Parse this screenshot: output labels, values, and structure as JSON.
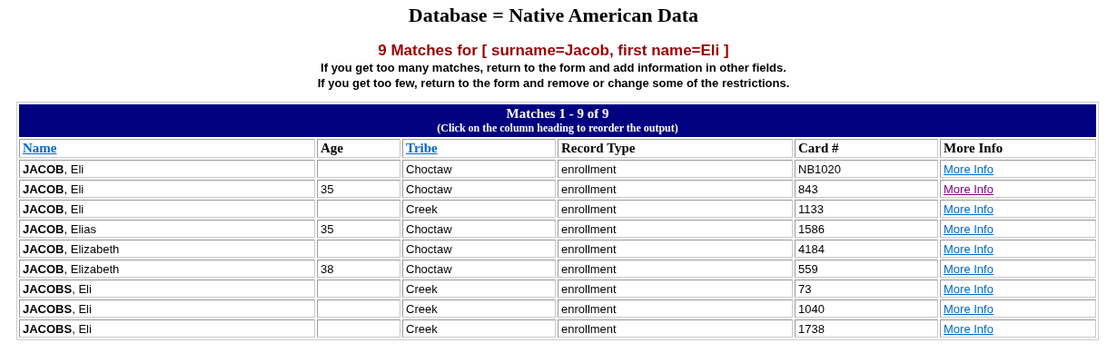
{
  "title": "Database = Native American Data",
  "matches_heading": "9 Matches for [ surname=Jacob, first name=Eli ]",
  "hints": [
    "If you get too many matches, return to the form and add information in other fields.",
    "If you get too few, return to the form and remove or change some of the restrictions."
  ],
  "table": {
    "caption": "Matches 1 - 9 of 9",
    "caption_note": "(Click on the column heading to reorder the output)",
    "columns": [
      {
        "label": "Name",
        "link": true
      },
      {
        "label": "Age",
        "link": false
      },
      {
        "label": "Tribe",
        "link": true
      },
      {
        "label": "Record Type",
        "link": false
      },
      {
        "label": "Card #",
        "link": false
      },
      {
        "label": "More Info",
        "link": false
      }
    ],
    "rows": [
      {
        "name": "**JACOB**, Eli",
        "age": "",
        "tribe": "Choctaw",
        "record_type": "enrollment",
        "card": "NB1020",
        "more_info": "More Info",
        "visited": false
      },
      {
        "name": "**JACOB**, Eli",
        "age": "35",
        "tribe": "Choctaw",
        "record_type": "enrollment",
        "card": "843",
        "more_info": "More Info",
        "visited": true
      },
      {
        "name": "**JACOB**, Eli",
        "age": "",
        "tribe": "Creek",
        "record_type": "enrollment",
        "card": "1133",
        "more_info": "More Info",
        "visited": false
      },
      {
        "name": "**JACOB**, Elias",
        "age": "35",
        "tribe": "Choctaw",
        "record_type": "enrollment",
        "card": "1586",
        "more_info": "More Info",
        "visited": false
      },
      {
        "name": "**JACOB**, Elizabeth",
        "age": "",
        "tribe": "Choctaw",
        "record_type": "enrollment",
        "card": "4184",
        "more_info": "More Info",
        "visited": false
      },
      {
        "name": "**JACOB**, Elizabeth",
        "age": "38",
        "tribe": "Choctaw",
        "record_type": "enrollment",
        "card": "559",
        "more_info": "More Info",
        "visited": false
      },
      {
        "name": "**JACOBS**, Eli",
        "age": "",
        "tribe": "Creek",
        "record_type": "enrollment",
        "card": "73",
        "more_info": "More Info",
        "visited": false
      },
      {
        "name": "**JACOBS**, Eli",
        "age": "",
        "tribe": "Creek",
        "record_type": "enrollment",
        "card": "1040",
        "more_info": "More Info",
        "visited": false
      },
      {
        "name": "**JACOBS**, Eli",
        "age": "",
        "tribe": "Creek",
        "record_type": "enrollment",
        "card": "1738",
        "more_info": "More Info",
        "visited": false
      }
    ]
  }
}
